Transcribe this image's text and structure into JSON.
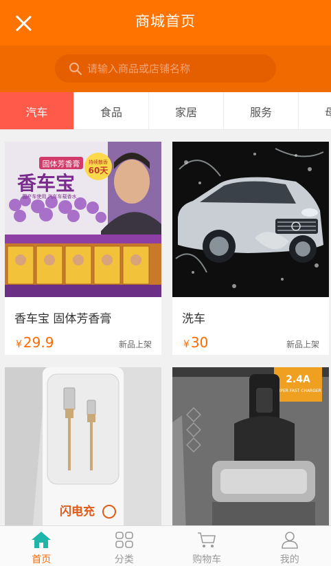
{
  "header": {
    "title": "商城首页"
  },
  "search": {
    "placeholder": "请输入商品或店铺名称"
  },
  "tabs": [
    {
      "label": "汽车",
      "active": true
    },
    {
      "label": "食品",
      "active": false
    },
    {
      "label": "家居",
      "active": false
    },
    {
      "label": "服务",
      "active": false
    },
    {
      "label": "母",
      "active": false
    }
  ],
  "products": [
    {
      "name": "香车宝 固体芳香膏",
      "currency": "¥",
      "price": "29.9",
      "tag": "新品上架",
      "image_text": {
        "brand": "香车宝",
        "ribbon": "固体芳香膏",
        "badge_top": "持续散香",
        "badge_num": "60天",
        "subtitle": "国产车使用 汽车车载香水"
      }
    },
    {
      "name": "洗车",
      "currency": "¥",
      "price": "30",
      "tag": "新品上架"
    },
    {
      "image_text": {
        "logo": "闪电充"
      }
    },
    {
      "image_text": {
        "badge": "2.4A",
        "small": "SUPER FAST CHARGER"
      }
    }
  ],
  "bottom_nav": [
    {
      "label": "首页",
      "icon": "home-icon",
      "active": true
    },
    {
      "label": "分类",
      "icon": "category-icon",
      "active": false
    },
    {
      "label": "购物车",
      "icon": "cart-icon",
      "active": false
    },
    {
      "label": "我的",
      "icon": "user-icon",
      "active": false
    }
  ],
  "colors": {
    "brand": "#ff7300",
    "active_tab": "#ff5a4a",
    "price": "#ff6a00",
    "nav_active": "#ff6a00"
  }
}
